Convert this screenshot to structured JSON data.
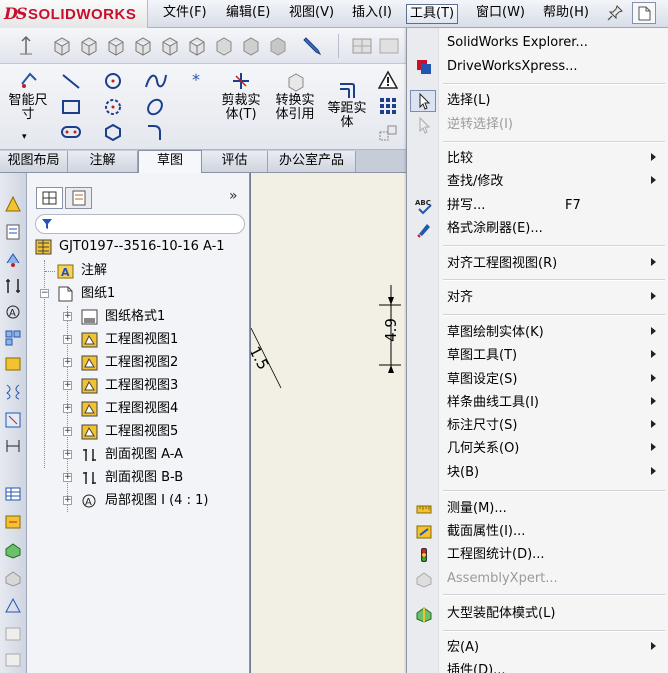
{
  "app": {
    "brand": "SOLIDWORKS",
    "brand_mark": "DS"
  },
  "menubar": {
    "items": [
      {
        "label": "文件(F)"
      },
      {
        "label": "编辑(E)"
      },
      {
        "label": "视图(V)"
      },
      {
        "label": "插入(I)"
      },
      {
        "label": "工具(T)",
        "active": true
      },
      {
        "label": "窗口(W)"
      },
      {
        "label": "帮助(H)"
      }
    ]
  },
  "ribbon": {
    "smart_dimension": "智能尺\n寸",
    "trim_entities": "剪裁实\n体(T)",
    "convert_entities": "转换实\n体引用",
    "offset_entities": "等距实\n体"
  },
  "tabs": [
    {
      "label": "视图布局"
    },
    {
      "label": "注解"
    },
    {
      "label": "草图",
      "active": true
    },
    {
      "label": "评估"
    },
    {
      "label": "办公室产品"
    }
  ],
  "tree": {
    "root": "GJT0197--3516-10-16 A-1",
    "annotations": "注解",
    "sheet": "图纸1",
    "children": [
      {
        "label": "图纸格式1",
        "icon": "sheet-format-icon"
      },
      {
        "label": "工程图视图1",
        "icon": "drawing-view-icon"
      },
      {
        "label": "工程图视图2",
        "icon": "drawing-view-icon"
      },
      {
        "label": "工程图视图3",
        "icon": "drawing-view-icon"
      },
      {
        "label": "工程图视图4",
        "icon": "drawing-view-icon"
      },
      {
        "label": "工程图视图5",
        "icon": "drawing-view-icon"
      },
      {
        "label": "剖面视图 A-A",
        "icon": "section-view-icon"
      },
      {
        "label": "剖面视图 B-B",
        "icon": "section-view-icon"
      },
      {
        "label": "局部视图 I (4 : 1)",
        "icon": "detail-view-icon"
      }
    ]
  },
  "canvas": {
    "dimension_vertical": "4.9",
    "dimension_angled": "1.5"
  },
  "tools_menu": {
    "items": [
      {
        "label": "SolidWorks Explorer...",
        "icon": "explorer-icon",
        "submenu": false,
        "disabled": false
      },
      {
        "label": "DriveWorksXpress...",
        "icon": "driveworks-icon",
        "submenu": false,
        "disabled": false
      },
      {
        "label": "选择(L)",
        "icon": "select-cursor-icon",
        "submenu": false,
        "disabled": false
      },
      {
        "label": "逆转选择(I)",
        "icon": "invert-select-icon",
        "submenu": false,
        "disabled": true
      },
      {
        "label": "比较",
        "icon": "",
        "submenu": true,
        "disabled": false
      },
      {
        "label": "查找/修改",
        "icon": "",
        "submenu": true,
        "disabled": false
      },
      {
        "label": "拼写...",
        "icon": "spell-check-icon",
        "shortcut": "F7",
        "submenu": false,
        "disabled": false
      },
      {
        "label": "格式涂刷器(E)...",
        "icon": "format-painter-icon",
        "submenu": false,
        "disabled": false
      },
      {
        "label": "对齐工程图视图(R)",
        "icon": "",
        "submenu": true,
        "disabled": false
      },
      {
        "label": "对齐",
        "icon": "",
        "submenu": true,
        "disabled": false
      },
      {
        "label": "草图绘制实体(K)",
        "icon": "",
        "submenu": true,
        "disabled": false
      },
      {
        "label": "草图工具(T)",
        "icon": "",
        "submenu": true,
        "disabled": false
      },
      {
        "label": "草图设定(S)",
        "icon": "",
        "submenu": true,
        "disabled": false
      },
      {
        "label": "样条曲线工具(I)",
        "icon": "",
        "submenu": true,
        "disabled": false
      },
      {
        "label": "标注尺寸(S)",
        "icon": "",
        "submenu": true,
        "disabled": false
      },
      {
        "label": "几何关系(O)",
        "icon": "",
        "submenu": true,
        "disabled": false
      },
      {
        "label": "块(B)",
        "icon": "",
        "submenu": true,
        "disabled": false
      },
      {
        "label": "测量(M)...",
        "icon": "measure-icon",
        "submenu": false,
        "disabled": false
      },
      {
        "label": "截面属性(I)...",
        "icon": "section-properties-icon",
        "submenu": false,
        "disabled": false
      },
      {
        "label": "工程图统计(D)...",
        "icon": "drawing-statistics-icon",
        "submenu": false,
        "disabled": false
      },
      {
        "label": "AssemblyXpert...",
        "icon": "assemblyxpert-icon",
        "submenu": false,
        "disabled": true
      },
      {
        "label": "大型装配体模式(L)",
        "icon": "large-assembly-icon",
        "submenu": false,
        "disabled": false
      },
      {
        "label": "宏(A)",
        "icon": "",
        "submenu": true,
        "disabled": false
      },
      {
        "label": "插件(D)...",
        "icon": "",
        "submenu": false,
        "disabled": false
      }
    ],
    "shortcut_spell": "F7"
  },
  "colors": {
    "brand_red": "#c8102e",
    "menu_bg": "#f5f5f5",
    "canvas_bg": "#f2f0e4",
    "toolbar_bg": "#e4e7ee"
  }
}
